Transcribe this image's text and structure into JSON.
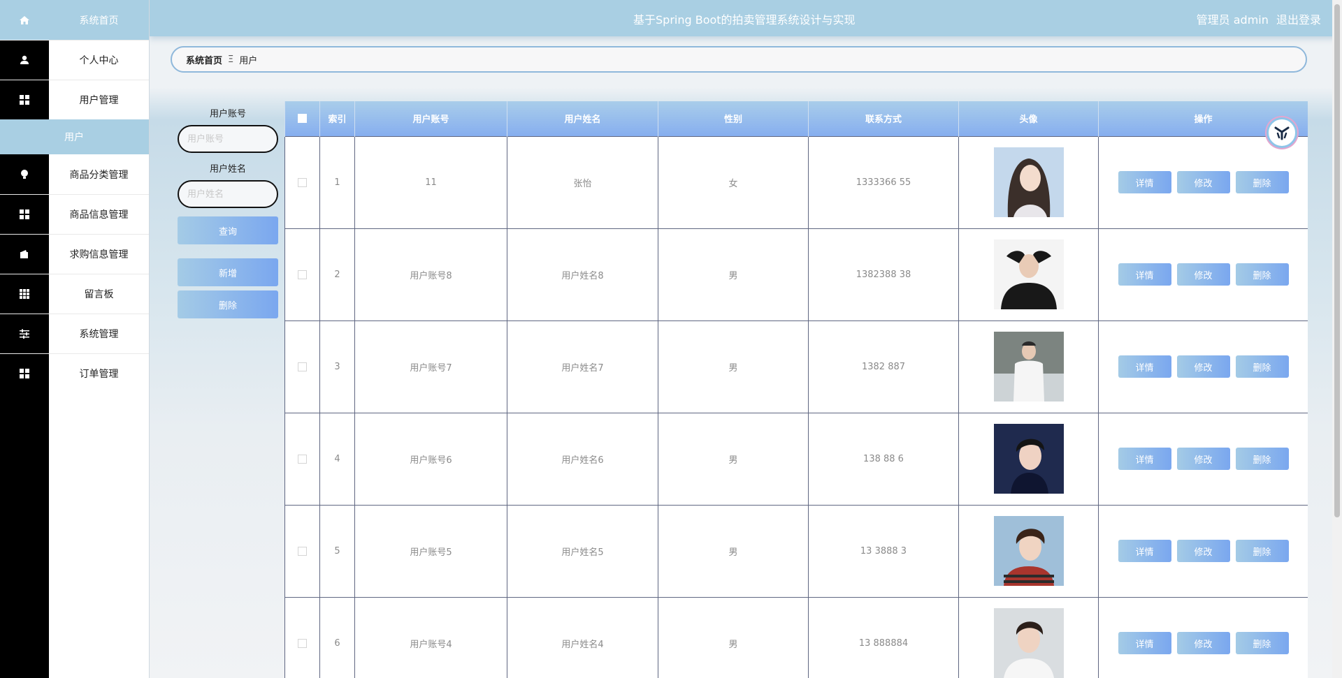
{
  "header": {
    "title": "基于Spring Boot的拍卖管理系统设计与实现",
    "user_label": "管理员 admin",
    "logout_label": "退出登录"
  },
  "sidebar": {
    "items": [
      {
        "label": "系统首页",
        "icon": "home-icon"
      },
      {
        "label": "个人中心",
        "icon": "user-icon"
      },
      {
        "label": "用户管理",
        "icon": "grid-icon"
      },
      {
        "label": "商品分类管理",
        "icon": "lightbulb-icon"
      },
      {
        "label": "商品信息管理",
        "icon": "grid-icon"
      },
      {
        "label": "求购信息管理",
        "icon": "wallet-icon"
      },
      {
        "label": "留言板",
        "icon": "table-icon"
      },
      {
        "label": "系统管理",
        "icon": "sliders-icon"
      },
      {
        "label": "订单管理",
        "icon": "grid-icon"
      }
    ],
    "sub_item": "用户"
  },
  "breadcrumb": {
    "home": "系统首页",
    "separator": "Ξ",
    "current": "用户"
  },
  "search": {
    "account_label": "用户账号",
    "account_placeholder": "用户账号",
    "name_label": "用户姓名",
    "name_placeholder": "用户姓名",
    "query_button": "查询",
    "add_button": "新增",
    "delete_button": "删除"
  },
  "table": {
    "headers": [
      "索引",
      "用户账号",
      "用户姓名",
      "性别",
      "联系方式",
      "头像",
      "操作"
    ],
    "rows": [
      {
        "index": "1",
        "account": "11",
        "name": "张怡",
        "gender": "女",
        "phone": "1333366  55"
      },
      {
        "index": "2",
        "account": "用户账号8",
        "name": "用户姓名8",
        "gender": "男",
        "phone": "1382388  38"
      },
      {
        "index": "3",
        "account": "用户账号7",
        "name": "用户姓名7",
        "gender": "男",
        "phone": "1382  887"
      },
      {
        "index": "4",
        "account": "用户账号6",
        "name": "用户姓名6",
        "gender": "男",
        "phone": "138  88  6"
      },
      {
        "index": "5",
        "account": "用户账号5",
        "name": "用户姓名5",
        "gender": "男",
        "phone": "13  3888  3"
      },
      {
        "index": "6",
        "account": "用户账号4",
        "name": "用户姓名4",
        "gender": "男",
        "phone": "13  888884"
      }
    ],
    "actions": {
      "detail": "详情",
      "edit": "修改",
      "delete": "删除"
    }
  },
  "colors": {
    "header_bg": "#a9cfe3",
    "sidebar_icon_bg": "#000000",
    "button_gradient_start": "#a4cbe6",
    "button_gradient_end": "#7aa7ef",
    "table_header": "#86aeef"
  }
}
